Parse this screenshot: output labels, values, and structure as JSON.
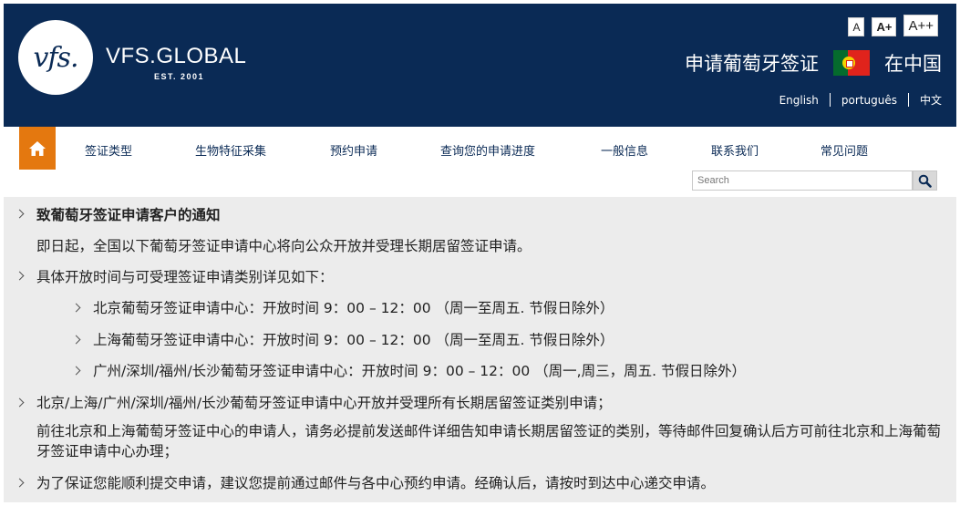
{
  "brand": {
    "logo_text": "vfs.",
    "name": "VFS.GLOBAL",
    "est": "EST. 2001"
  },
  "font_size_controls": [
    "A",
    "A+",
    "A++"
  ],
  "header": {
    "title": "申请葡萄牙签证",
    "region": "在中国",
    "languages": [
      "English",
      "português",
      "中文"
    ]
  },
  "nav": {
    "items": [
      "签证类型",
      "生物特征采集",
      "预约申请",
      "查询您的申请进度",
      "一般信息",
      "联系我们",
      "常见问题"
    ],
    "search_placeholder": "Search"
  },
  "notice": {
    "heading": "致葡萄牙签证申请客户的通知",
    "intro": "即日起，全国以下葡萄牙签证申请中心将向公众开放并受理长期居留签证申请。",
    "hours_heading": "具体开放时间与可受理签证申请类别详见如下：",
    "centers": [
      "北京葡萄牙签证申请中心：开放时间 9：00 – 12：00 （周一至周五. 节假日除外）",
      "上海葡萄牙签证申请中心：开放时间 9：00 – 12：00 （周一至周五. 节假日除外）",
      "广州/深圳/福州/长沙葡萄牙签证申请中心：开放时间 9：00 – 12：00 （周一,周三，周五. 节假日除外）"
    ],
    "all_categories": "北京/上海/广州/深圳/福州/长沙葡萄牙签证申请中心开放并受理所有长期居留签证类别申请；",
    "email_note": "前往北京和上海葡萄牙签证中心的申请人，请务必提前发送邮件详细告知申请长期居留签证的类别，等待邮件回复确认后方可前往北京和上海葡萄牙签证申请中心办理；",
    "appointment_note": "为了保证您能顺利提交申请，建议您提前通过邮件与各中心预约申请。经确认后，请按时到达中心递交申请。"
  },
  "colors": {
    "header_bg": "#0a2a55",
    "home_button": "#e4780f",
    "content_bg": "#ececec"
  }
}
